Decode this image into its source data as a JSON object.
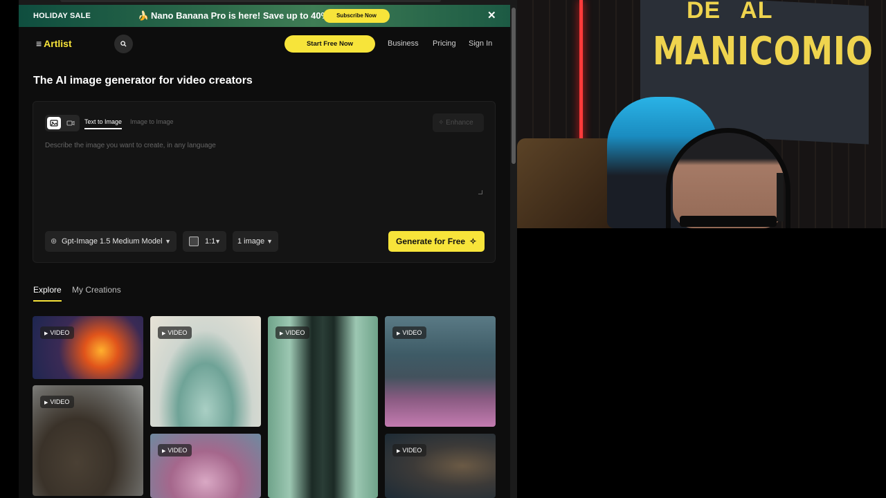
{
  "promo": {
    "sale_label": "HOLIDAY SALE",
    "emoji": "🍌",
    "message": "Nano Banana Pro is here! Save up to 40%",
    "subscribe_label": "Subscribe Now",
    "close_glyph": "✕"
  },
  "nav": {
    "logo_text": "Artlist",
    "menu_glyph": "≡",
    "start_label": "Start Free Now",
    "links": [
      "Business",
      "Pricing",
      "Sign In"
    ]
  },
  "page": {
    "heading": "The AI image generator for video creators"
  },
  "generator": {
    "tab_text_to_image": "Text to Image",
    "tab_image_to_image": "Image to Image",
    "enhance_label": "Enhance",
    "prompt_placeholder": "Describe the image you want to create, in any language",
    "model_label": "Gpt-Image 1.5 Medium Model",
    "ratio_label": "1:1",
    "count_label": "1 image",
    "generate_label": "Generate for Free"
  },
  "gallery": {
    "tabs": [
      "Explore",
      "My Creations"
    ],
    "badge_label": "VIDEO"
  },
  "webcam": {
    "banner_line1": "DE",
    "banner_line2": "AL",
    "banner_line3": "MANICOMIO"
  },
  "colors": {
    "accent": "#f7e43a",
    "background": "#0d0d0d",
    "panel": "#141414"
  }
}
